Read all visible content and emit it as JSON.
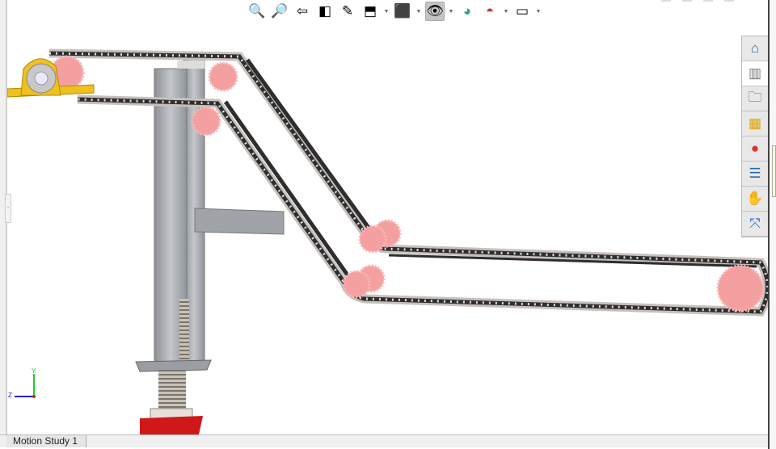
{
  "toolbar": {
    "items": [
      {
        "icon": "zoom-to-fit-icon",
        "glyph": "🔍"
      },
      {
        "icon": "zoom-to-area-icon",
        "glyph": "🔎"
      },
      {
        "icon": "previous-view-icon",
        "glyph": "⇦"
      },
      {
        "icon": "section-view-icon",
        "glyph": "◧"
      },
      {
        "icon": "dynamic-annotation-views-icon",
        "glyph": "✎"
      },
      {
        "icon": "view-orientation-icon",
        "glyph": "⬒"
      },
      {
        "icon": "display-style-icon",
        "glyph": "⬛"
      },
      {
        "icon": "hide-show-items-icon",
        "glyph": "👁"
      },
      {
        "icon": "edit-appearance-icon",
        "glyph": "◕"
      },
      {
        "icon": "apply-scene-icon",
        "glyph": "◓"
      },
      {
        "icon": "view-settings-icon",
        "glyph": "▭"
      }
    ]
  },
  "task_pane": {
    "items": [
      {
        "icon": "solidworks-resources-home-icon",
        "glyph": "⌂"
      },
      {
        "icon": "design-library-icon",
        "glyph": "▥"
      },
      {
        "icon": "file-explorer-folder-icon",
        "glyph": "🗀"
      },
      {
        "icon": "view-palette-icon",
        "glyph": "▦"
      },
      {
        "icon": "appearances-scenes-icon",
        "glyph": "●"
      },
      {
        "icon": "custom-properties-icon",
        "glyph": "☰"
      },
      {
        "icon": "solidworks-forum-icon",
        "glyph": "✋"
      },
      {
        "icon": "motion-icon",
        "glyph": "⤧"
      }
    ]
  },
  "triad": {
    "y_label": "Y",
    "z_label": "Z"
  },
  "bottom": {
    "motion_study_tab": "Motion Study 1"
  },
  "colors": {
    "chain": "#2e2e2e",
    "links": "#c8c0bc",
    "sprocket": "#f4a0a0",
    "steel": "#a9adb0",
    "bearing": "#f0c020",
    "base": "#d01818"
  }
}
